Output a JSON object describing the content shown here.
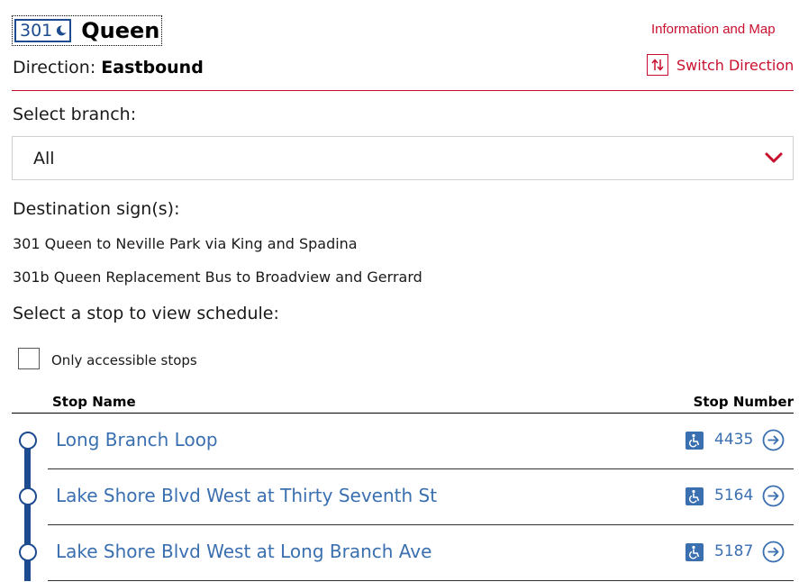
{
  "route": {
    "number": "301",
    "night_icon": "moon-icon",
    "name": "Queen",
    "direction_label": "Direction:",
    "direction_value": "Eastbound"
  },
  "links": {
    "info_map": "Information and Map",
    "switch_direction": "Switch Direction"
  },
  "branch": {
    "label": "Select branch:",
    "selected": "All"
  },
  "destination": {
    "label": "Destination sign(s):",
    "signs": [
      "301 Queen to Neville Park via King and Spadina",
      "301b Queen Replacement Bus to Broadview and Gerrard"
    ]
  },
  "stops_section": {
    "label": "Select a stop to view schedule:",
    "accessible_filter_label": "Only accessible stops",
    "accessible_filter_checked": false,
    "col_stop_name": "Stop Name",
    "col_stop_number": "Stop Number",
    "stops": [
      {
        "name": "Long Branch Loop",
        "number": "4435",
        "accessible": true
      },
      {
        "name": "Lake Shore Blvd West at Thirty Seventh St",
        "number": "5164",
        "accessible": true
      },
      {
        "name": "Lake Shore Blvd West at Long Branch Ave",
        "number": "5187",
        "accessible": true
      }
    ]
  },
  "colors": {
    "accent_red": "#c8102e",
    "route_blue": "#1c4b8f",
    "link_blue": "#3a6fb0"
  }
}
